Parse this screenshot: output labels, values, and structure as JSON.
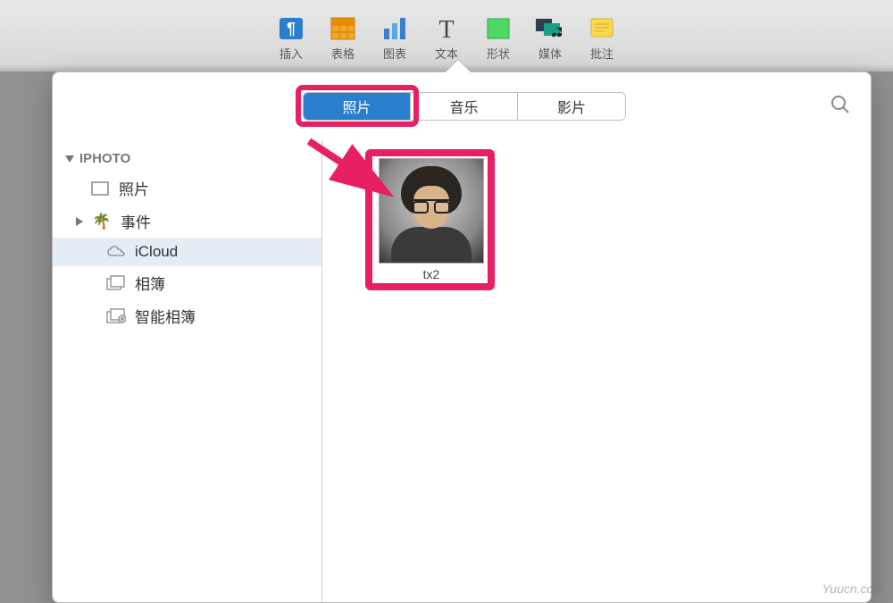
{
  "toolbar": {
    "items": [
      {
        "label": "插入",
        "icon": "pilcrow-icon"
      },
      {
        "label": "表格",
        "icon": "table-icon"
      },
      {
        "label": "图表",
        "icon": "chart-icon"
      },
      {
        "label": "文本",
        "icon": "text-icon"
      },
      {
        "label": "形状",
        "icon": "shape-icon"
      },
      {
        "label": "媒体",
        "icon": "media-icon"
      },
      {
        "label": "批注",
        "icon": "comment-icon"
      }
    ]
  },
  "segmented": {
    "photos": "照片",
    "music": "音乐",
    "movies": "影片"
  },
  "sidebar": {
    "header": "IPHOTO",
    "items": {
      "photos": "照片",
      "events": "事件",
      "icloud": "iCloud",
      "albums": "相簿",
      "smart_albums": "智能相簿"
    }
  },
  "content": {
    "photo_label": "tx2"
  },
  "watermark": "Yuucn.com",
  "colors": {
    "highlight": "#e81f63",
    "active_tab": "#2a7ece"
  }
}
